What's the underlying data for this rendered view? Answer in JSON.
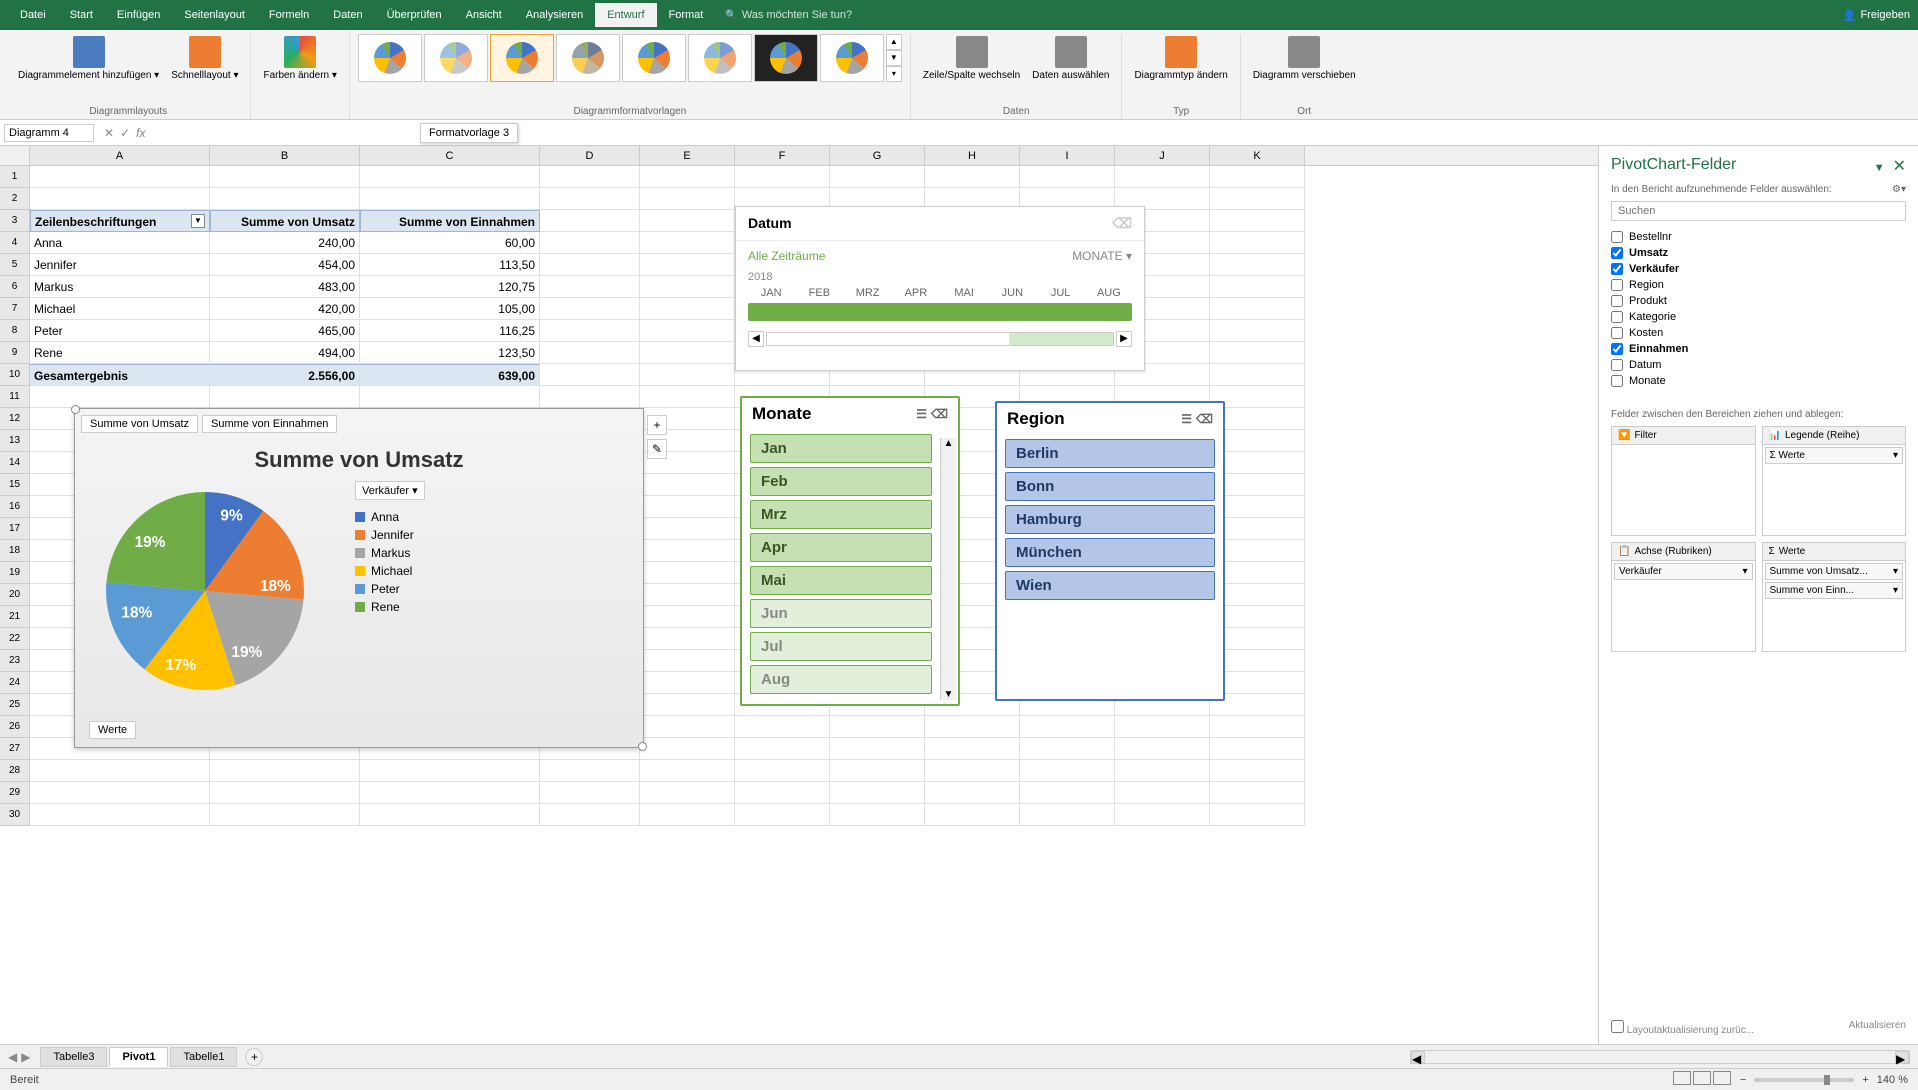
{
  "tabs": [
    "Datei",
    "Start",
    "Einfügen",
    "Seitenlayout",
    "Formeln",
    "Daten",
    "Überprüfen",
    "Ansicht",
    "Analysieren",
    "Entwurf",
    "Format"
  ],
  "active_tab": "Entwurf",
  "search_placeholder": "Was möchten Sie tun?",
  "share": "Freigeben",
  "ribbon": {
    "layouts": {
      "btn1": "Diagrammelement hinzufügen ▾",
      "btn2": "Schnelllayout ▾",
      "group": "Diagrammlayouts"
    },
    "colors": {
      "btn": "Farben ändern ▾"
    },
    "styles_group": "Diagrammformatvorlagen",
    "tooltip": "Formatvorlage 3",
    "data": {
      "btn1": "Zeile/Spalte wechseln",
      "btn2": "Daten auswählen",
      "group": "Daten"
    },
    "type": {
      "btn": "Diagrammtyp ändern",
      "group": "Typ"
    },
    "loc": {
      "btn": "Diagramm verschieben",
      "group": "Ort"
    }
  },
  "name_box": "Diagramm 4",
  "columns": [
    "A",
    "B",
    "C",
    "D",
    "E",
    "F",
    "G",
    "H",
    "I",
    "J",
    "K"
  ],
  "pivot": {
    "headers": [
      "Zeilenbeschriftungen",
      "Summe von Umsatz",
      "Summe von Einnahmen"
    ],
    "rows": [
      {
        "name": "Anna",
        "umsatz": "240,00",
        "einnahmen": "60,00"
      },
      {
        "name": "Jennifer",
        "umsatz": "454,00",
        "einnahmen": "113,50"
      },
      {
        "name": "Markus",
        "umsatz": "483,00",
        "einnahmen": "120,75"
      },
      {
        "name": "Michael",
        "umsatz": "420,00",
        "einnahmen": "105,00"
      },
      {
        "name": "Peter",
        "umsatz": "465,00",
        "einnahmen": "116,25"
      },
      {
        "name": "Rene",
        "umsatz": "494,00",
        "einnahmen": "123,50"
      }
    ],
    "total": {
      "label": "Gesamtergebnis",
      "umsatz": "2.556,00",
      "einnahmen": "639,00"
    }
  },
  "chart": {
    "tab1": "Summe von Umsatz",
    "tab2": "Summe von Einnahmen",
    "title": "Summe von Umsatz",
    "legend_drop": "Verkäufer ▾",
    "legend": [
      "Anna",
      "Jennifer",
      "Markus",
      "Michael",
      "Peter",
      "Rene"
    ],
    "colors": [
      "#4472c4",
      "#ed7d31",
      "#a5a5a5",
      "#ffc000",
      "#5b9bd5",
      "#70ad47"
    ],
    "labels": [
      "9%",
      "18%",
      "19%",
      "17%",
      "18%",
      "19%"
    ],
    "values_label": "Werte"
  },
  "chart_data": {
    "type": "pie",
    "title": "Summe von Umsatz",
    "series": [
      {
        "name": "Verkäufer",
        "categories": [
          "Anna",
          "Jennifer",
          "Markus",
          "Michael",
          "Peter",
          "Rene"
        ],
        "values": [
          240,
          454,
          483,
          420,
          465,
          494
        ],
        "percentages": [
          9,
          18,
          19,
          17,
          18,
          19
        ]
      }
    ]
  },
  "timeline": {
    "title": "Datum",
    "range": "Alle Zeiträume",
    "unit": "MONATE ▾",
    "year": "2018",
    "months": [
      "JAN",
      "FEB",
      "MRZ",
      "APR",
      "MAI",
      "JUN",
      "JUL",
      "AUG"
    ]
  },
  "slicer_monate": {
    "title": "Monate",
    "items": [
      "Jan",
      "Feb",
      "Mrz",
      "Apr",
      "Mai",
      "Jun",
      "Jul",
      "Aug"
    ],
    "dim_from": 5
  },
  "slicer_region": {
    "title": "Region",
    "items": [
      "Berlin",
      "Bonn",
      "Hamburg",
      "München",
      "Wien"
    ]
  },
  "fields_pane": {
    "title": "PivotChart-Felder",
    "subtitle": "In den Bericht aufzunehmende Felder auswählen:",
    "search": "Suchen",
    "fields": [
      {
        "name": "Bestellnr",
        "checked": false
      },
      {
        "name": "Umsatz",
        "checked": true
      },
      {
        "name": "Verkäufer",
        "checked": true
      },
      {
        "name": "Region",
        "checked": false
      },
      {
        "name": "Produkt",
        "checked": false
      },
      {
        "name": "Kategorie",
        "checked": false
      },
      {
        "name": "Kosten",
        "checked": false
      },
      {
        "name": "Einnahmen",
        "checked": true
      },
      {
        "name": "Datum",
        "checked": false
      },
      {
        "name": "Monate",
        "checked": false
      }
    ],
    "areas_label": "Felder zwischen den Bereichen ziehen und ablegen:",
    "area_filter": "Filter",
    "area_legend": "Legende (Reihe)",
    "area_legend_item": "Werte",
    "area_axis": "Achse (Rubriken)",
    "area_axis_item": "Verkäufer",
    "area_values": "Werte",
    "area_values_items": [
      "Summe von Umsatz...",
      "Summe von Einn..."
    ],
    "defer": "Layoutaktualisierung zurüc...",
    "update": "Aktualisieren"
  },
  "sheet_tabs": [
    "Tabelle3",
    "Pivot1",
    "Tabelle1"
  ],
  "active_sheet": "Pivot1",
  "status": "Bereit",
  "zoom": "140 %"
}
